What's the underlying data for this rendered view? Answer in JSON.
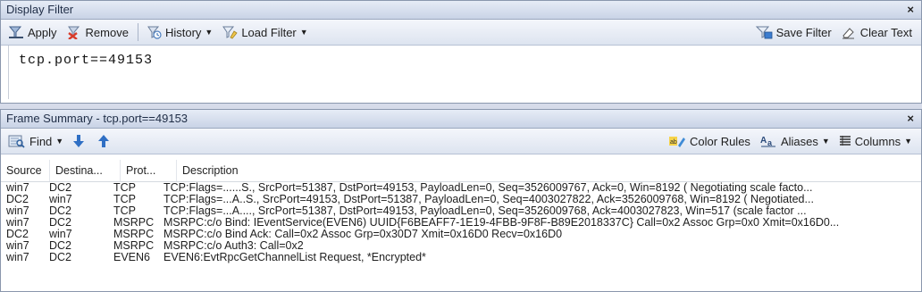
{
  "filter_pane": {
    "title": "Display Filter",
    "close": "×",
    "toolbar": {
      "apply": "Apply",
      "remove": "Remove",
      "history": "History",
      "load_filter": "Load Filter",
      "save_filter": "Save Filter",
      "clear_text": "Clear Text"
    },
    "filter_text": "tcp.port==49153"
  },
  "summary_pane": {
    "title": "Frame Summary - tcp.port==49153",
    "close": "×",
    "toolbar": {
      "find": "Find",
      "color_rules": "Color Rules",
      "aliases": "Aliases",
      "columns": "Columns"
    },
    "columns": [
      "Source",
      "Destina...",
      "Prot...",
      "Description"
    ],
    "rows": [
      [
        "win7",
        "DC2",
        "TCP",
        "TCP:Flags=......S., SrcPort=51387, DstPort=49153, PayloadLen=0, Seq=3526009767, Ack=0, Win=8192 ( Negotiating scale facto..."
      ],
      [
        "DC2",
        "win7",
        "TCP",
        "TCP:Flags=...A..S., SrcPort=49153, DstPort=51387, PayloadLen=0, Seq=4003027822, Ack=3526009768, Win=8192 ( Negotiated..."
      ],
      [
        "win7",
        "DC2",
        "TCP",
        "TCP:Flags=...A...., SrcPort=51387, DstPort=49153, PayloadLen=0, Seq=3526009768, Ack=4003027823, Win=517 (scale factor ..."
      ],
      [
        "win7",
        "DC2",
        "MSRPC",
        "MSRPC:c/o Bind: IEventService(EVEN6) UUID{F6BEAFF7-1E19-4FBB-9F8F-B89E2018337C}  Call=0x2  Assoc Grp=0x0  Xmit=0x16D0..."
      ],
      [
        "DC2",
        "win7",
        "MSRPC",
        "MSRPC:c/o Bind Ack:  Call=0x2  Assoc Grp=0x30D7  Xmit=0x16D0  Recv=0x16D0"
      ],
      [
        "win7",
        "DC2",
        "MSRPC",
        "MSRPC:c/o Auth3:  Call=0x2"
      ],
      [
        "win7",
        "DC2",
        "EVEN6",
        "EVEN6:EvtRpcGetChannelList Request, *Encrypted*"
      ]
    ]
  }
}
